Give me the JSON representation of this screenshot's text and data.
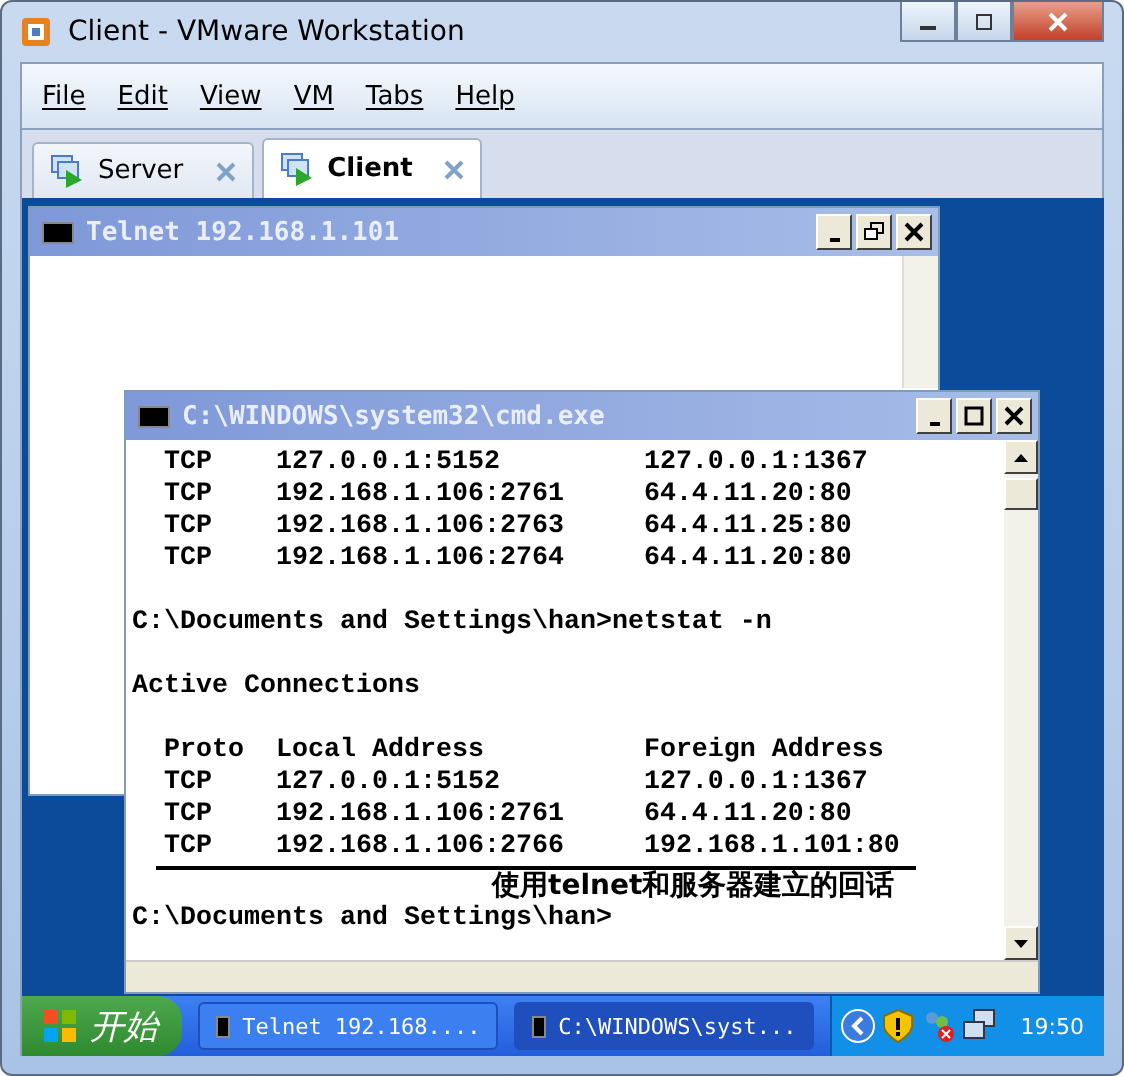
{
  "window": {
    "title": "Client - VMware Workstation"
  },
  "menu": [
    "File",
    "Edit",
    "View",
    "VM",
    "Tabs",
    "Help"
  ],
  "tabs": [
    {
      "label": "Server",
      "selected": false
    },
    {
      "label": "Client",
      "selected": true
    }
  ],
  "telnet_window": {
    "title": "Telnet 192.168.1.101"
  },
  "cmd_window": {
    "title": "C:\\WINDOWS\\system32\\cmd.exe",
    "blocks": [
      {
        "lines": [
          "  TCP    127.0.0.1:5152         127.0.0.1:1367",
          "  TCP    192.168.1.106:2761     64.4.11.20:80",
          "  TCP    192.168.1.106:2763     64.4.11.25:80",
          "  TCP    192.168.1.106:2764     64.4.11.20:80"
        ]
      },
      {
        "lines": [
          "C:\\Documents and Settings\\han>netstat -n"
        ]
      },
      {
        "lines": [
          "Active Connections"
        ]
      },
      {
        "lines": [
          "  Proto  Local Address          Foreign Address",
          "  TCP    127.0.0.1:5152         127.0.0.1:1367",
          "  TCP    192.168.1.106:2761     64.4.11.20:80",
          "  TCP    192.168.1.106:2766     192.168.1.101:80"
        ],
        "note": "使用telnet和服务器建立的回话"
      },
      {
        "lines": [
          "C:\\Documents and Settings\\han>"
        ]
      }
    ]
  },
  "taskbar": {
    "start": "开始",
    "tasks": [
      {
        "label": "Telnet 192.168....",
        "selected": false
      },
      {
        "label": "C:\\WINDOWS\\syst...",
        "selected": true
      }
    ],
    "clock": "19:50"
  }
}
